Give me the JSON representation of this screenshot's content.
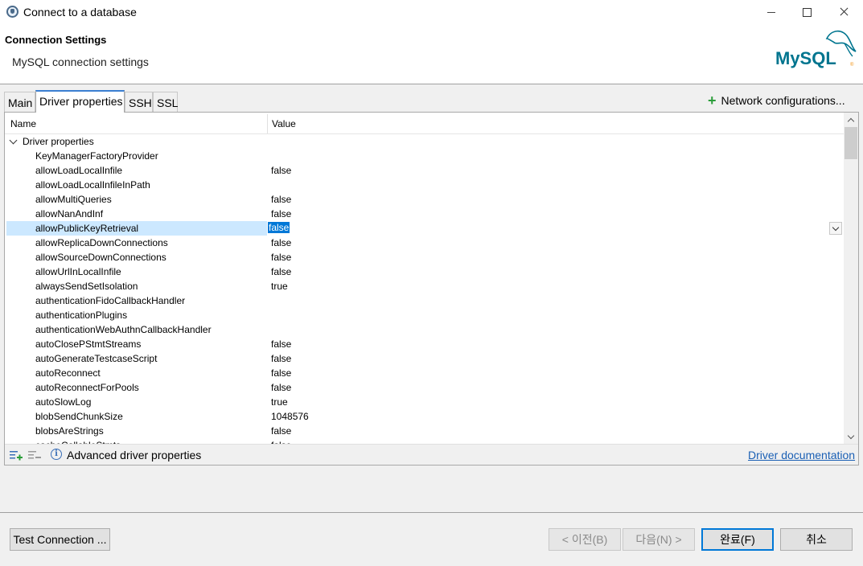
{
  "window": {
    "title": "Connect to a database"
  },
  "header": {
    "title": "Connection Settings",
    "subtitle": "MySQL connection settings",
    "logo_text": "MySQL"
  },
  "tabs": [
    {
      "label": "Main",
      "active": false
    },
    {
      "label": "Driver properties",
      "active": true
    },
    {
      "label": "SSH",
      "active": false
    },
    {
      "label": "SSL",
      "active": false
    }
  ],
  "network_config_label": "Network configurations...",
  "table": {
    "columns": {
      "name": "Name",
      "value": "Value"
    },
    "group_label": "Driver properties",
    "rows": [
      {
        "name": "KeyManagerFactoryProvider",
        "value": ""
      },
      {
        "name": "allowLoadLocalInfile",
        "value": "false"
      },
      {
        "name": "allowLoadLocalInfileInPath",
        "value": ""
      },
      {
        "name": "allowMultiQueries",
        "value": "false"
      },
      {
        "name": "allowNanAndInf",
        "value": "false"
      },
      {
        "name": "allowPublicKeyRetrieval",
        "value": "false",
        "selected": true
      },
      {
        "name": "allowReplicaDownConnections",
        "value": "false"
      },
      {
        "name": "allowSourceDownConnections",
        "value": "false"
      },
      {
        "name": "allowUrlInLocalInfile",
        "value": "false"
      },
      {
        "name": "alwaysSendSetIsolation",
        "value": "true"
      },
      {
        "name": "authenticationFidoCallbackHandler",
        "value": ""
      },
      {
        "name": "authenticationPlugins",
        "value": ""
      },
      {
        "name": "authenticationWebAuthnCallbackHandler",
        "value": ""
      },
      {
        "name": "autoClosePStmtStreams",
        "value": "false"
      },
      {
        "name": "autoGenerateTestcaseScript",
        "value": "false"
      },
      {
        "name": "autoReconnect",
        "value": "false"
      },
      {
        "name": "autoReconnectForPools",
        "value": "false"
      },
      {
        "name": "autoSlowLog",
        "value": "true"
      },
      {
        "name": "blobSendChunkSize",
        "value": "1048576"
      },
      {
        "name": "blobsAreStrings",
        "value": "false"
      },
      {
        "name": "cacheCallableStmts",
        "value": "false"
      }
    ]
  },
  "footer": {
    "advanced_label": "Advanced driver properties",
    "doc_link": "Driver documentation"
  },
  "buttons": {
    "test": "Test Connection ...",
    "prev": "< 이전(B)",
    "next": "다음(N) >",
    "finish": "완료(F)",
    "cancel": "취소"
  },
  "colors": {
    "accent": "#0078d7",
    "selection": "#cce8ff",
    "mysql_blue": "#00758f",
    "mysql_orange": "#f29111"
  }
}
